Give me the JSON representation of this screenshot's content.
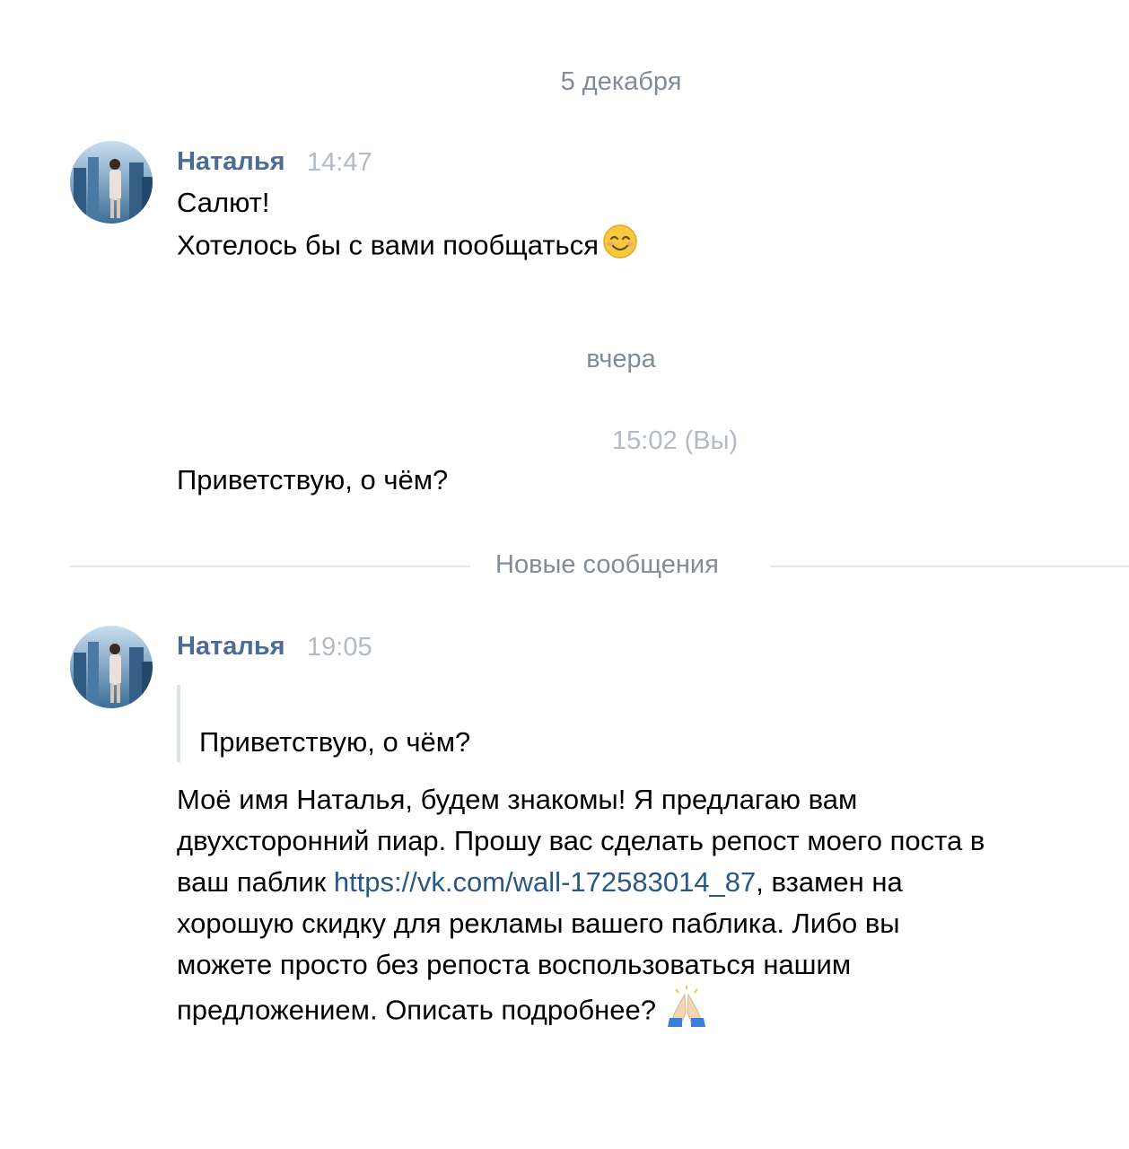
{
  "chat": {
    "date_separators": {
      "first": "5 декабря",
      "second": "вчера"
    },
    "messages": [
      {
        "author": "Наталья",
        "time": "14:47",
        "lines": [
          "Салют!",
          "Хотелось бы с вами пообщаться"
        ],
        "emoji": "smiling-face-emoji"
      },
      {
        "time": "15:02 (Вы)",
        "lines": [
          "Приветствую, о чём?"
        ]
      },
      {
        "author": "Наталья",
        "time": "19:05",
        "quote": {
          "text": "Приветствую, о чём?"
        },
        "body": {
          "line1": "Моё имя Наталья, будем знакомы! Я предлагаю вам",
          "line2": "двухсторонний пиар. Прошу вас сделать репост моего поста в",
          "line3_before": "ваш паблик ",
          "line3_link": "https://vk.com/wall-172583014_87",
          "line3_after": ", взамен на",
          "line4": "хорошую скидку для рекламы вашего паблика. Либо вы",
          "line5": "можете просто без репоста воспользоваться нашим",
          "line6": "предложением. Описать подробнее?"
        },
        "emoji": "folded-hands-emoji"
      }
    ],
    "new_messages_divider": "Новые сообщения"
  },
  "colors": {
    "author": "#4a6c96",
    "timestamp": "#b2bac4",
    "separator_text": "#818c99",
    "link": "#2a5885",
    "divider": "#e3e6ea"
  }
}
